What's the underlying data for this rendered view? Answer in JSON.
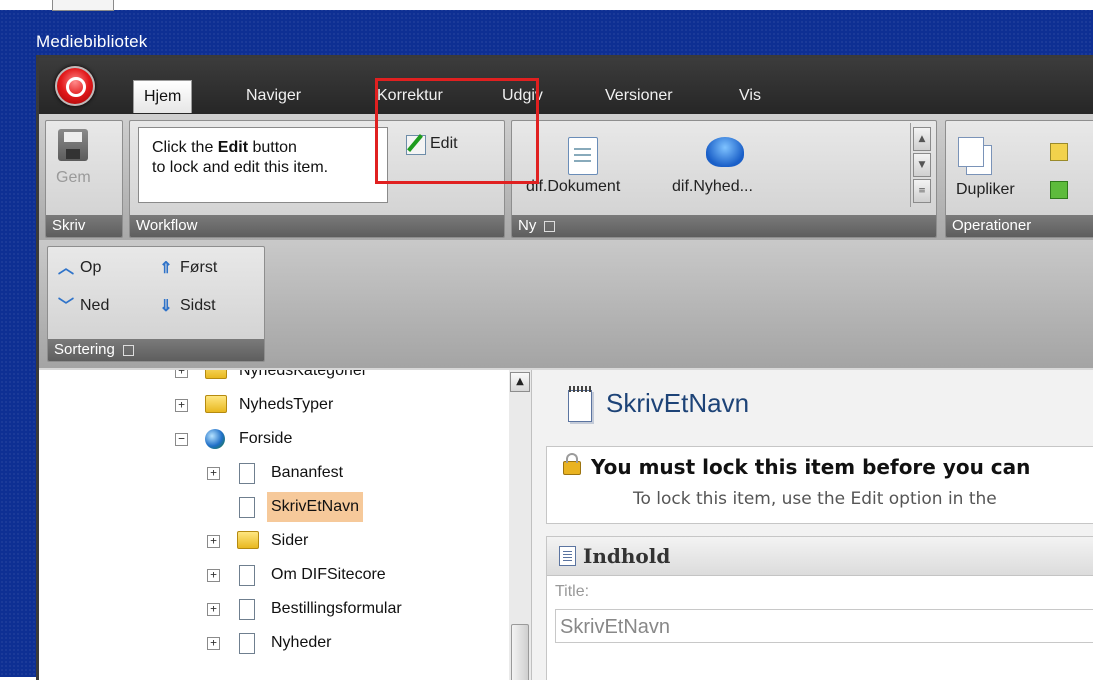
{
  "window": {
    "title": "Mediebibliotek"
  },
  "tabs": [
    {
      "label": "Hjem",
      "active": true
    },
    {
      "label": "Naviger"
    },
    {
      "label": "Korrektur"
    },
    {
      "label": "Udgiv"
    },
    {
      "label": "Versioner"
    },
    {
      "label": "Vis"
    }
  ],
  "ribbon": {
    "skriv": {
      "save_label": "Gem",
      "group_label": "Skriv"
    },
    "workflow": {
      "text_line1_pre": "Click the ",
      "text_line1_bold": "Edit",
      "text_line1_post": " button",
      "text_line2": "to lock and edit this item.",
      "edit_label": "Edit",
      "group_label": "Workflow"
    },
    "ny": {
      "item1_label": "dif.Dokument",
      "item2_label": "dif.Nyhed...",
      "group_label": "Ny"
    },
    "operationer": {
      "duplicate_label": "Dupliker",
      "group_label": "Operationer"
    }
  },
  "sorting": {
    "up_label": "Op",
    "first_label": "Først",
    "down_label": "Ned",
    "last_label": "Sidst",
    "group_label": "Sortering"
  },
  "tree": {
    "items": [
      {
        "label": "NyhedsKategorier",
        "expander": "+",
        "icon": "folder-icon"
      },
      {
        "label": "NyhedsTyper",
        "expander": "+",
        "icon": "folder-icon"
      },
      {
        "label": "Forside",
        "expander": "−",
        "icon": "globe-icon"
      },
      {
        "label": "Bananfest",
        "expander": "+",
        "icon": "page-icon"
      },
      {
        "label": "SkrivEtNavn",
        "expander": "",
        "icon": "page-icon",
        "selected": true
      },
      {
        "label": "Sider",
        "expander": "+",
        "icon": "folder-icon"
      },
      {
        "label": "Om DIFSitecore",
        "expander": "+",
        "icon": "page-icon"
      },
      {
        "label": "Bestillingsformular",
        "expander": "+",
        "icon": "page-icon"
      },
      {
        "label": "Nyheder",
        "expander": "+",
        "icon": "page-icon"
      }
    ]
  },
  "content": {
    "item_title": "SkrivEtNavn",
    "warning_title": "You must lock this item before you can",
    "warning_sub": "To lock this item, use the Edit option in the",
    "section_title": "Indhold",
    "field_label": "Title:",
    "field_value": "SkrivEtNavn"
  },
  "colors": {
    "desktop": "#0e2f93",
    "highlight": "#e02020",
    "selected_row": "#f6c99a",
    "title_blue": "#1d4377"
  }
}
